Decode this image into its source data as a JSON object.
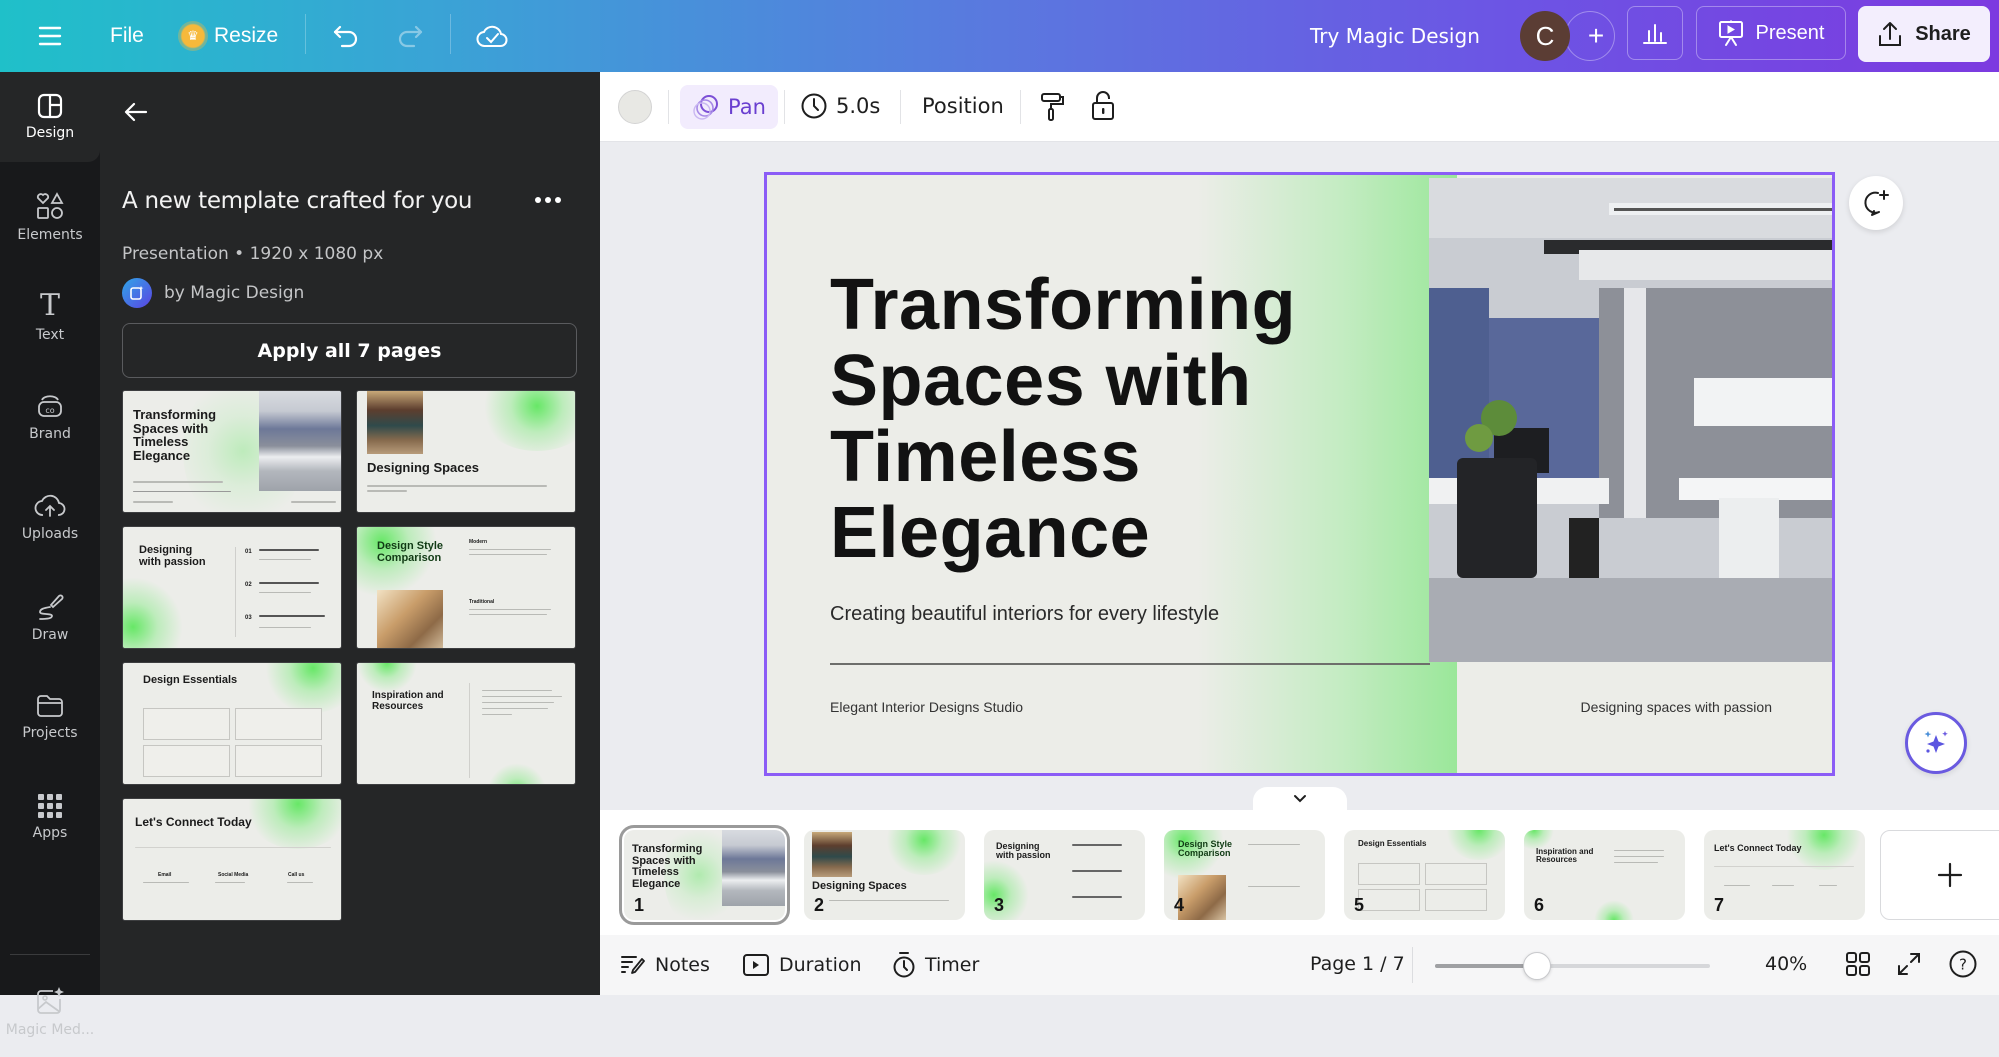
{
  "topbar": {
    "menu_icon": "hamburger-menu-icon",
    "file_label": "File",
    "resize_label": "Resize",
    "resize_icon": "crown-icon",
    "undo_icon": "undo-icon",
    "redo_icon": "redo-icon",
    "save_status_icon": "cloud-check-icon",
    "magic_design_label": "Try Magic Design",
    "avatar_initial": "C",
    "add_collaborator_icon": "plus-icon",
    "insights_icon": "bar-chart-icon",
    "present_label": "Present",
    "present_icon": "presentation-icon",
    "share_label": "Share",
    "share_icon": "upload-icon"
  },
  "rail": {
    "items": [
      {
        "label": "Design",
        "icon": "layout-icon",
        "active": true
      },
      {
        "label": "Elements",
        "icon": "shapes-icon"
      },
      {
        "label": "Text",
        "icon": "text-icon"
      },
      {
        "label": "Brand",
        "icon": "brand-icon"
      },
      {
        "label": "Uploads",
        "icon": "cloud-upload-icon"
      },
      {
        "label": "Draw",
        "icon": "pen-icon"
      },
      {
        "label": "Projects",
        "icon": "folder-icon"
      },
      {
        "label": "Apps",
        "icon": "grid-icon"
      },
      {
        "label": "Magic Med...",
        "icon": "magic-media-icon"
      }
    ]
  },
  "panel": {
    "title": "A new template crafted for you",
    "meta": "Presentation • 1920 x 1080 px",
    "author": "by Magic Design",
    "apply_label": "Apply all 7 pages",
    "templates": [
      {
        "title": "Transforming Spaces with Timeless Elegance"
      },
      {
        "title": "Designing Spaces"
      },
      {
        "title": "Designing with passion",
        "items": [
          "01",
          "02",
          "03"
        ]
      },
      {
        "title": "Design Style Comparison",
        "labels": [
          "Modern",
          "Traditional"
        ]
      },
      {
        "title": "Design Essentials"
      },
      {
        "title": "Inspiration and Resources"
      },
      {
        "title": "Let's Connect Today",
        "labels": [
          "Email",
          "Social Media",
          "Call us"
        ]
      }
    ]
  },
  "context_toolbar": {
    "pan_label": "Pan",
    "duration_value": "5.0s",
    "position_label": "Position",
    "paint_icon": "paint-roller-icon",
    "lock_icon": "unlock-icon"
  },
  "slide": {
    "title_lines": [
      "Transforming",
      "Spaces with",
      "Timeless",
      "Elegance"
    ],
    "subtitle": "Creating beautiful interiors for every lifestyle",
    "footer_left": "Elegant Interior Designs Studio",
    "footer_right": "Designing spaces with passion",
    "selection_color": "#8b5cf6"
  },
  "pages": [
    {
      "num": "1",
      "title": "Transforming Spaces with Timeless Elegance",
      "selected": true
    },
    {
      "num": "2",
      "title": "Designing Spaces"
    },
    {
      "num": "3",
      "title": "Designing with passion"
    },
    {
      "num": "4",
      "title": "Design Style Comparison"
    },
    {
      "num": "5",
      "title": "Design Essentials"
    },
    {
      "num": "6",
      "title": "Inspiration and Resources"
    },
    {
      "num": "7",
      "title": "Let's Connect Today"
    }
  ],
  "bottombar": {
    "notes_label": "Notes",
    "duration_label": "Duration",
    "timer_label": "Timer",
    "page_indicator": "Page 1 / 7",
    "zoom_percent": "40%",
    "zoom_fraction": 0.37
  }
}
